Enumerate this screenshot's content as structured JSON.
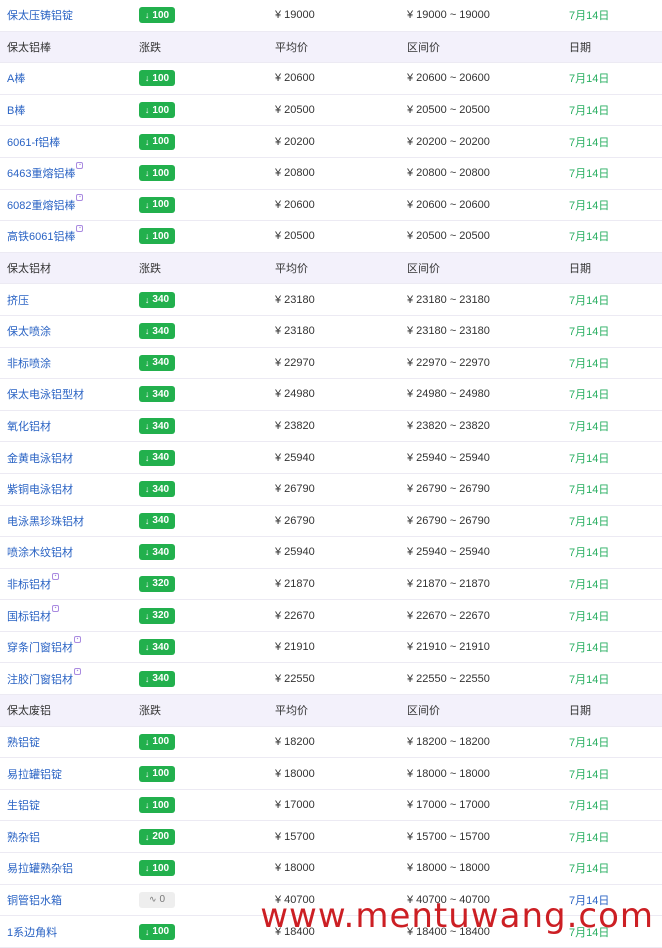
{
  "rows": [
    {
      "kind": "data",
      "name": "保太压铸铝锭",
      "change": "100",
      "dir": "down",
      "avg": "¥ 19000",
      "range": "¥ 19000 ~ 19000",
      "date": "7月14日"
    },
    {
      "kind": "header",
      "name": "保太铝棒",
      "change": "涨跌",
      "avg": "平均价",
      "range": "区间价",
      "date": "日期"
    },
    {
      "kind": "data",
      "name": "A棒",
      "change": "100",
      "dir": "down",
      "avg": "¥ 20600",
      "range": "¥ 20600 ~ 20600",
      "date": "7月14日"
    },
    {
      "kind": "data",
      "name": "B棒",
      "change": "100",
      "dir": "down",
      "avg": "¥ 20500",
      "range": "¥ 20500 ~ 20500",
      "date": "7月14日"
    },
    {
      "kind": "data",
      "name": "6061-f铝棒",
      "change": "100",
      "dir": "down",
      "avg": "¥ 20200",
      "range": "¥ 20200 ~ 20200",
      "date": "7月14日"
    },
    {
      "kind": "data",
      "name": "6463重熔铝棒",
      "mark": true,
      "change": "100",
      "dir": "down",
      "avg": "¥ 20800",
      "range": "¥ 20800 ~ 20800",
      "date": "7月14日"
    },
    {
      "kind": "data",
      "name": "6082重熔铝棒",
      "mark": true,
      "change": "100",
      "dir": "down",
      "avg": "¥ 20600",
      "range": "¥ 20600 ~ 20600",
      "date": "7月14日"
    },
    {
      "kind": "data",
      "name": "高铁6061铝棒",
      "mark": true,
      "change": "100",
      "dir": "down",
      "avg": "¥ 20500",
      "range": "¥ 20500 ~ 20500",
      "date": "7月14日"
    },
    {
      "kind": "header",
      "name": "保太铝材",
      "change": "涨跌",
      "avg": "平均价",
      "range": "区间价",
      "date": "日期"
    },
    {
      "kind": "data",
      "name": "挤压",
      "change": "340",
      "dir": "down",
      "avg": "¥ 23180",
      "range": "¥ 23180 ~ 23180",
      "date": "7月14日"
    },
    {
      "kind": "data",
      "name": "保太喷涂",
      "change": "340",
      "dir": "down",
      "avg": "¥ 23180",
      "range": "¥ 23180 ~ 23180",
      "date": "7月14日"
    },
    {
      "kind": "data",
      "name": "非标喷涂",
      "change": "340",
      "dir": "down",
      "avg": "¥ 22970",
      "range": "¥ 22970 ~ 22970",
      "date": "7月14日"
    },
    {
      "kind": "data",
      "name": "保太电泳铝型材",
      "change": "340",
      "dir": "down",
      "avg": "¥ 24980",
      "range": "¥ 24980 ~ 24980",
      "date": "7月14日"
    },
    {
      "kind": "data",
      "name": "氧化铝材",
      "change": "340",
      "dir": "down",
      "avg": "¥ 23820",
      "range": "¥ 23820 ~ 23820",
      "date": "7月14日"
    },
    {
      "kind": "data",
      "name": "金黄电泳铝材",
      "change": "340",
      "dir": "down",
      "avg": "¥ 25940",
      "range": "¥ 25940 ~ 25940",
      "date": "7月14日"
    },
    {
      "kind": "data",
      "name": "紫铜电泳铝材",
      "change": "340",
      "dir": "down",
      "avg": "¥ 26790",
      "range": "¥ 26790 ~ 26790",
      "date": "7月14日"
    },
    {
      "kind": "data",
      "name": "电泳黑珍珠铝材",
      "change": "340",
      "dir": "down",
      "avg": "¥ 26790",
      "range": "¥ 26790 ~ 26790",
      "date": "7月14日"
    },
    {
      "kind": "data",
      "name": "喷涂木纹铝材",
      "change": "340",
      "dir": "down",
      "avg": "¥ 25940",
      "range": "¥ 25940 ~ 25940",
      "date": "7月14日"
    },
    {
      "kind": "data",
      "name": "非标铝材",
      "mark": true,
      "change": "320",
      "dir": "down",
      "avg": "¥ 21870",
      "range": "¥ 21870 ~ 21870",
      "date": "7月14日"
    },
    {
      "kind": "data",
      "name": "国标铝材",
      "mark": true,
      "change": "320",
      "dir": "down",
      "avg": "¥ 22670",
      "range": "¥ 22670 ~ 22670",
      "date": "7月14日"
    },
    {
      "kind": "data",
      "name": "穿条门窗铝材",
      "mark": true,
      "change": "340",
      "dir": "down",
      "avg": "¥ 21910",
      "range": "¥ 21910 ~ 21910",
      "date": "7月14日"
    },
    {
      "kind": "data",
      "name": "注胶门窗铝材",
      "mark": true,
      "change": "340",
      "dir": "down",
      "avg": "¥ 22550",
      "range": "¥ 22550 ~ 22550",
      "date": "7月14日"
    },
    {
      "kind": "header",
      "name": "保太废铝",
      "change": "涨跌",
      "avg": "平均价",
      "range": "区间价",
      "date": "日期"
    },
    {
      "kind": "data",
      "name": "熟铝锭",
      "change": "100",
      "dir": "down",
      "avg": "¥ 18200",
      "range": "¥ 18200 ~ 18200",
      "date": "7月14日"
    },
    {
      "kind": "data",
      "name": "易拉罐铝锭",
      "change": "100",
      "dir": "down",
      "avg": "¥ 18000",
      "range": "¥ 18000 ~ 18000",
      "date": "7月14日"
    },
    {
      "kind": "data",
      "name": "生铝锭",
      "change": "100",
      "dir": "down",
      "avg": "¥ 17000",
      "range": "¥ 17000 ~ 17000",
      "date": "7月14日"
    },
    {
      "kind": "data",
      "name": "熟杂铝",
      "change": "200",
      "dir": "down",
      "avg": "¥ 15700",
      "range": "¥ 15700 ~ 15700",
      "date": "7月14日"
    },
    {
      "kind": "data",
      "name": "易拉罐熟杂铝",
      "change": "100",
      "dir": "down",
      "avg": "¥ 18000",
      "range": "¥ 18000 ~ 18000",
      "date": "7月14日"
    },
    {
      "kind": "data",
      "name": "铜管铝水箱",
      "change": "0",
      "dir": "flat",
      "avg": "¥ 40700",
      "range": "¥ 40700 ~ 40700",
      "date": "7月14日",
      "date_color": "blue"
    },
    {
      "kind": "data",
      "name": "1系边角料",
      "change": "100",
      "dir": "down",
      "avg": "¥ 18400",
      "range": "¥ 18400 ~ 18400",
      "date": "7月14日"
    }
  ],
  "site_watermark": "www.mentuwang.com"
}
